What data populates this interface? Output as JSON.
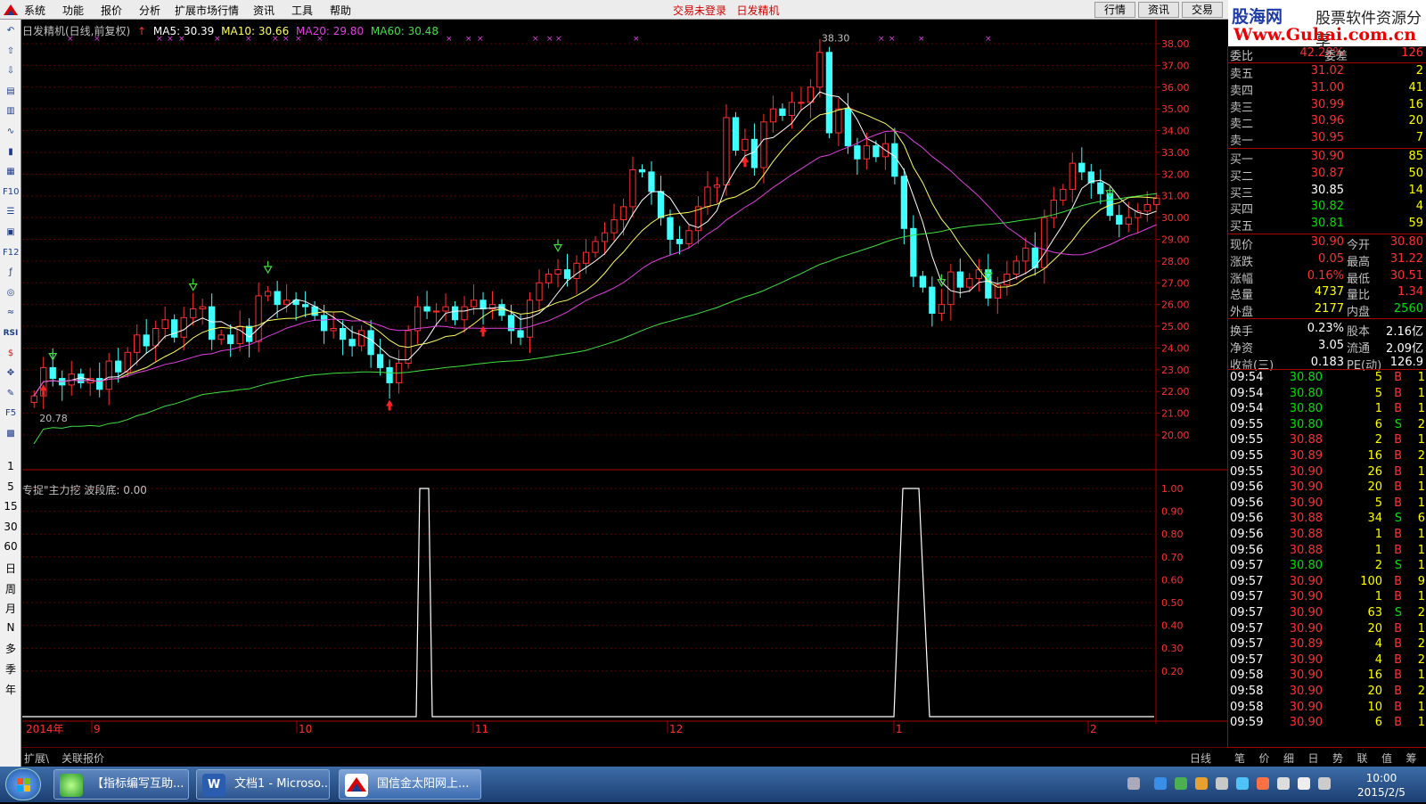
{
  "menu": {
    "items": [
      "系统",
      "功能",
      "报价",
      "分析",
      "扩展市场行情",
      "资讯",
      "工具",
      "帮助"
    ],
    "login_status": "交易未登录",
    "product": "日发精机",
    "right_tabs": [
      "行情",
      "资讯",
      "交易"
    ]
  },
  "banner": {
    "name": "股海网",
    "slogan": "股票软件资源分享",
    "url": "Www.Guhai.com.cn"
  },
  "left_toolbar": {
    "icons": [
      "back-icon",
      "up-arrow-icon",
      "down-arrow-icon",
      "quote-icon",
      "bar-icon",
      "line-chart-icon",
      "candle-icon",
      "layout-icon",
      "f10-icon",
      "news-icon",
      "finance-icon",
      "f12-icon",
      "f10b-icon",
      "circle-icon",
      "wave-icon",
      "rsi-icon",
      "dollar-icon",
      "move-icon",
      "pencil-icon",
      "f5-icon",
      "image-icon"
    ],
    "periods": [
      "1",
      "5",
      "15",
      "30",
      "60",
      "日",
      "周",
      "月",
      "N",
      "多",
      "季",
      "年"
    ]
  },
  "chart": {
    "title": "日发精机(日线,前复权)",
    "ma5": "MA5: 30.39",
    "ma10": "MA10: 30.66",
    "ma20": "MA20: 29.80",
    "ma60": "MA60: 30.48",
    "high_label": "38.30",
    "low_label": "20.78",
    "indicator_title": "专捉\"主力挖 波段底: 0.00",
    "period_label": "日线",
    "bottom_tabs": [
      "扩展\\",
      "关联报价"
    ],
    "colors": {
      "up": "#ff3030",
      "down": "#40ffff",
      "ma5": "#ffffff",
      "ma10": "#ffff60",
      "ma20": "#e040e0",
      "ma60": "#40e040",
      "grid": "#600000"
    }
  },
  "chart_data": {
    "type": "candlestick",
    "price_axis": {
      "min": 20,
      "max": 38,
      "ticks": [
        "38.00",
        "37.00",
        "36.00",
        "35.00",
        "34.00",
        "33.00",
        "32.00",
        "31.00",
        "30.00",
        "29.00",
        "28.00",
        "27.00",
        "26.00",
        "25.00",
        "24.00",
        "23.00",
        "22.00",
        "21.00",
        "20.00"
      ]
    },
    "indicator_axis": {
      "min": 0,
      "max": 1,
      "ticks": [
        "1.00",
        "0.90",
        "0.80",
        "0.70",
        "0.60",
        "0.50",
        "0.40",
        "0.30",
        "0.20"
      ]
    },
    "time_labels": [
      "2014年",
      "9",
      "10",
      "11",
      "12",
      "1",
      "2"
    ],
    "close": [
      21.8,
      23.1,
      22.6,
      22.3,
      22.8,
      22.4,
      22.6,
      22.1,
      23.4,
      22.9,
      23.8,
      24.6,
      24.1,
      24.9,
      25.3,
      24.5,
      25.4,
      25.8,
      25.9,
      24.4,
      24.6,
      24.2,
      25.0,
      24.3,
      26.4,
      26.6,
      26.0,
      26.2,
      26.0,
      25.9,
      25.5,
      24.8,
      24.9,
      24.4,
      24.1,
      24.8,
      23.7,
      23.1,
      22.4,
      23.3,
      24.8,
      25.9,
      25.7,
      25.7,
      25.9,
      25.3,
      25.9,
      26.2,
      25.8,
      26.0,
      25.5,
      24.8,
      24.5,
      26.2,
      27.0,
      27.4,
      27.6,
      27.2,
      27.9,
      28.4,
      28.9,
      29.3,
      29.9,
      30.5,
      32.2,
      32.1,
      31.2,
      30.0,
      29.0,
      28.8,
      29.4,
      30.5,
      31.4,
      31.5,
      34.6,
      33.1,
      33.6,
      32.3,
      34.4,
      35.0,
      34.7,
      35.3,
      35.3,
      36.0,
      37.6,
      33.9,
      35.0,
      33.3,
      32.7,
      33.3,
      32.8,
      33.4,
      31.9,
      29.5,
      27.3,
      26.8,
      25.6,
      26.0,
      27.5,
      26.8,
      27.2,
      27.6,
      26.3,
      26.9,
      27.4,
      28.0,
      28.6,
      27.7,
      30.0,
      30.8,
      31.3,
      32.5,
      32.1,
      31.6,
      31.1,
      30.1,
      29.7,
      30.0,
      30.3,
      30.6,
      30.9
    ],
    "series": [
      {
        "name": "MA5",
        "close_window": 5
      },
      {
        "name": "MA10",
        "close_window": 10
      },
      {
        "name": "MA20",
        "close_window": 20
      },
      {
        "name": "MA60",
        "close_window": 60
      }
    ],
    "indicator_peaks": [
      [
        442,
        0
      ],
      [
        446,
        1
      ],
      [
        456,
        1
      ],
      [
        460,
        0
      ],
      [
        978,
        0
      ],
      [
        988,
        1
      ],
      [
        1006,
        1
      ],
      [
        1018,
        0
      ]
    ],
    "buy_arrows": [
      25,
      56,
      102,
      123,
      138,
      218,
      236
    ],
    "sell_arrows": [
      38,
      48,
      76,
      197,
      243
    ]
  },
  "quote_panel": {
    "weibi": {
      "label": "委比",
      "value": "42.28%",
      "label2": "委差",
      "value2": "126"
    },
    "sell": [
      {
        "label": "卖五",
        "price": "31.02",
        "vol": "2"
      },
      {
        "label": "卖四",
        "price": "31.00",
        "vol": "41"
      },
      {
        "label": "卖三",
        "price": "30.99",
        "vol": "16"
      },
      {
        "label": "卖二",
        "price": "30.96",
        "vol": "20"
      },
      {
        "label": "卖一",
        "price": "30.95",
        "vol": "7"
      }
    ],
    "buy": [
      {
        "label": "买一",
        "price": "30.90",
        "vol": "85"
      },
      {
        "label": "买二",
        "price": "30.87",
        "vol": "50"
      },
      {
        "label": "买三",
        "price": "30.85",
        "vol": "14"
      },
      {
        "label": "买四",
        "price": "30.82",
        "vol": "4"
      },
      {
        "label": "买五",
        "price": "30.81",
        "vol": "59"
      }
    ],
    "stats": [
      {
        "l1": "现价",
        "v1": "30.90",
        "l2": "今开",
        "v2": "30.80"
      },
      {
        "l1": "涨跌",
        "v1": "0.05",
        "l2": "最高",
        "v2": "31.22"
      },
      {
        "l1": "涨幅",
        "v1": "0.16%",
        "l2": "最低",
        "v2": "30.51"
      },
      {
        "l1": "总量",
        "v1": "4737",
        "l2": "量比",
        "v2": "1.34"
      },
      {
        "l1": "外盘",
        "v1": "2177",
        "l2": "内盘",
        "v2": "2560"
      },
      {
        "l1": "换手",
        "v1": "0.23%",
        "l2": "股本",
        "v2": "2.16亿"
      },
      {
        "l1": "净资",
        "v1": "3.05",
        "l2": "流通",
        "v2": "2.09亿"
      },
      {
        "l1": "收益(三)",
        "v1": "0.183",
        "l2": "PE(动)",
        "v2": "126.9"
      }
    ],
    "ticks": [
      [
        "09:54",
        "30.80",
        "5",
        "B",
        "1"
      ],
      [
        "09:54",
        "30.80",
        "5",
        "B",
        "1"
      ],
      [
        "09:54",
        "30.80",
        "1",
        "B",
        "1"
      ],
      [
        "09:55",
        "30.80",
        "6",
        "S",
        "2"
      ],
      [
        "09:55",
        "30.88",
        "2",
        "B",
        "1"
      ],
      [
        "09:55",
        "30.89",
        "16",
        "B",
        "2"
      ],
      [
        "09:55",
        "30.90",
        "26",
        "B",
        "1"
      ],
      [
        "09:56",
        "30.90",
        "20",
        "B",
        "1"
      ],
      [
        "09:56",
        "30.90",
        "5",
        "B",
        "1"
      ],
      [
        "09:56",
        "30.88",
        "34",
        "S",
        "6"
      ],
      [
        "09:56",
        "30.88",
        "1",
        "B",
        "1"
      ],
      [
        "09:56",
        "30.88",
        "1",
        "B",
        "1"
      ],
      [
        "09:57",
        "30.80",
        "2",
        "S",
        "1"
      ],
      [
        "09:57",
        "30.90",
        "100",
        "B",
        "9"
      ],
      [
        "09:57",
        "30.90",
        "1",
        "B",
        "1"
      ],
      [
        "09:57",
        "30.90",
        "63",
        "S",
        "2"
      ],
      [
        "09:57",
        "30.90",
        "20",
        "B",
        "1"
      ],
      [
        "09:57",
        "30.89",
        "4",
        "B",
        "2"
      ],
      [
        "09:57",
        "30.90",
        "4",
        "B",
        "2"
      ],
      [
        "09:58",
        "30.90",
        "16",
        "B",
        "1"
      ],
      [
        "09:58",
        "30.90",
        "20",
        "B",
        "2"
      ],
      [
        "09:58",
        "30.90",
        "10",
        "B",
        "1"
      ],
      [
        "09:59",
        "30.90",
        "6",
        "B",
        "1"
      ]
    ],
    "tabs": [
      "笔",
      "价",
      "细",
      "日",
      "势",
      "联",
      "值",
      "筹"
    ]
  },
  "taskbar": {
    "tasks": [
      "【指标编写互助...",
      "文档1 - Microso...",
      "国信金太阳网上..."
    ],
    "time": "10:00",
    "date": "2015/2/5"
  }
}
